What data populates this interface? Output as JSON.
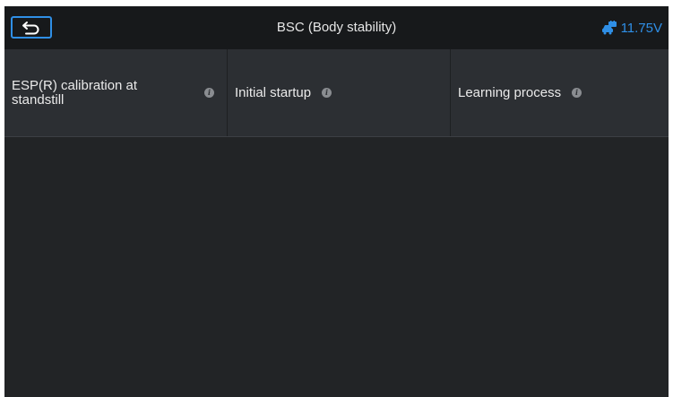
{
  "header": {
    "title": "BSC (Body stability)",
    "voltage": "11.75V",
    "back_icon": "back-arrow-icon",
    "battery_icon": "vehicle-battery-icon",
    "accent_color": "#2f8fe6"
  },
  "functions": [
    {
      "label": "ESP(R) calibration at standstill",
      "icon": "info-icon"
    },
    {
      "label": "Initial startup",
      "icon": "info-icon"
    },
    {
      "label": "Learning process",
      "icon": "info-icon"
    }
  ]
}
